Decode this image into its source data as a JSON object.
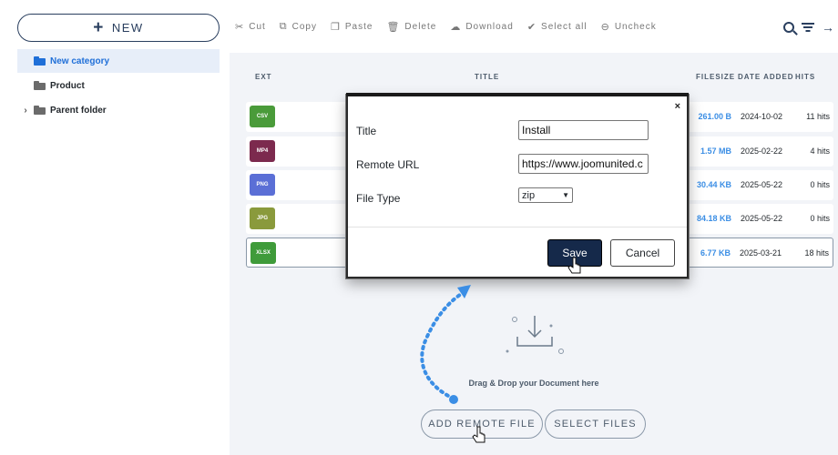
{
  "sidebar": {
    "new_button": "NEW",
    "categories": [
      {
        "label": "New category",
        "active": true,
        "expandable": false
      },
      {
        "label": "Product",
        "active": false,
        "expandable": false
      },
      {
        "label": "Parent folder",
        "active": false,
        "expandable": true
      }
    ]
  },
  "toolbar": {
    "items": [
      {
        "icon": "scissors-icon",
        "label": "Cut"
      },
      {
        "icon": "copy-icon",
        "label": "Copy"
      },
      {
        "icon": "paste-icon",
        "label": "Paste"
      },
      {
        "icon": "trash-icon",
        "label": "Delete"
      },
      {
        "icon": "download-icon",
        "label": "Download"
      },
      {
        "icon": "check-all-icon",
        "label": "Select all"
      },
      {
        "icon": "uncheck-icon",
        "label": "Uncheck"
      }
    ]
  },
  "table": {
    "columns": {
      "ext": "EXT",
      "title": "TITLE",
      "filesize": "FILESIZE",
      "date_added": "DATE ADDED",
      "hits": "HITS"
    },
    "rows": [
      {
        "ext": "CSV",
        "color": "#4a9b3a",
        "filesize": "261.00 B",
        "date": "2024-10-02",
        "hits": "11 hits",
        "selected": false
      },
      {
        "ext": "MP4",
        "color": "#7c2a4e",
        "filesize": "1.57 MB",
        "date": "2025-02-22",
        "hits": "4 hits",
        "selected": false
      },
      {
        "ext": "PNG",
        "color": "#5b6fd6",
        "filesize": "30.44 KB",
        "date": "2025-05-22",
        "hits": "0 hits",
        "selected": false
      },
      {
        "ext": "JPG",
        "color": "#8a9a3c",
        "filesize": "84.18 KB",
        "date": "2025-05-22",
        "hits": "0 hits",
        "selected": false
      },
      {
        "ext": "XLSX",
        "color": "#3f9b3a",
        "filesize": "6.77 KB",
        "date": "2025-03-21",
        "hits": "18 hits",
        "selected": true
      }
    ]
  },
  "upload": {
    "drag_text": "Drag & Drop your Document here",
    "add_remote": "ADD REMOTE FILE",
    "select_files": "SELECT FILES"
  },
  "modal": {
    "close": "×",
    "title_label": "Title",
    "title_value": "Install",
    "url_label": "Remote URL",
    "url_value": "https://www.joomunited.c",
    "type_label": "File Type",
    "type_value": "zip",
    "save": "Save",
    "cancel": "Cancel"
  },
  "colors": {
    "accent": "#1f6fd8",
    "navy": "#15294a",
    "filesize_blue": "#3b8ee5",
    "annotation_blue": "#3b8ee5"
  }
}
